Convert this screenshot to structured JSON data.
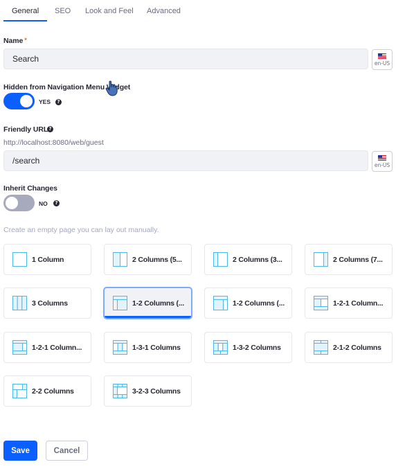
{
  "tabs": [
    {
      "label": "General",
      "active": true
    },
    {
      "label": "SEO",
      "active": false
    },
    {
      "label": "Look and Feel",
      "active": false
    },
    {
      "label": "Advanced",
      "active": false
    }
  ],
  "name_field": {
    "label": "Name",
    "required_mark": "*",
    "value": "Search",
    "language": "en-US",
    "language_icon": "us-flag-icon"
  },
  "hidden_toggle": {
    "label": "Hidden from Navigation Menu Widget",
    "state": "YES",
    "checked": true,
    "help_icon": "question-circle-icon"
  },
  "friendly_url": {
    "label": "Friendly URL",
    "help_icon": "question-circle-icon",
    "prefix": "http://localhost:8080/web/guest",
    "value": "/search",
    "language": "en-US"
  },
  "inherit_toggle": {
    "label": "Inherit Changes",
    "state": "NO",
    "checked": false,
    "help_icon": "question-circle-icon"
  },
  "layout_hint": "Create an empty page you can lay out manually.",
  "layouts": [
    {
      "label": "1 Column",
      "icon": "layout-1-column-icon",
      "selected": false
    },
    {
      "label": "2 Columns (5...",
      "icon": "layout-2-columns-50-50-icon",
      "selected": false
    },
    {
      "label": "2 Columns (3...",
      "icon": "layout-2-columns-30-70-icon",
      "selected": false
    },
    {
      "label": "2 Columns (7...",
      "icon": "layout-2-columns-70-30-icon",
      "selected": false
    },
    {
      "label": "3 Columns",
      "icon": "layout-3-columns-icon",
      "selected": false
    },
    {
      "label": "1-2 Columns (...",
      "icon": "layout-1-2-columns-30-70-icon",
      "selected": true
    },
    {
      "label": "1-2 Columns (...",
      "icon": "layout-1-2-columns-70-30-icon",
      "selected": false
    },
    {
      "label": "1-2-1 Column...",
      "icon": "layout-1-2-1-columns-50-50-icon",
      "selected": false
    },
    {
      "label": "1-2-1 Column...",
      "icon": "layout-1-2-1-columns-70-30-icon",
      "selected": false
    },
    {
      "label": "1-3-1 Columns",
      "icon": "layout-1-3-1-columns-icon",
      "selected": false
    },
    {
      "label": "1-3-2 Columns",
      "icon": "layout-1-3-2-columns-icon",
      "selected": false
    },
    {
      "label": "2-1-2 Columns",
      "icon": "layout-2-1-2-columns-icon",
      "selected": false
    },
    {
      "label": "2-2 Columns",
      "icon": "layout-2-2-columns-icon",
      "selected": false
    },
    {
      "label": "3-2-3 Columns",
      "icon": "layout-3-2-3-columns-icon",
      "selected": false
    }
  ],
  "actions": {
    "save_label": "Save",
    "cancel_label": "Cancel"
  },
  "colors": {
    "primary": "#0b5fff",
    "layout_icon_stroke": "#4fb8ea",
    "layout_icon_fill": "#e3f3fc"
  }
}
